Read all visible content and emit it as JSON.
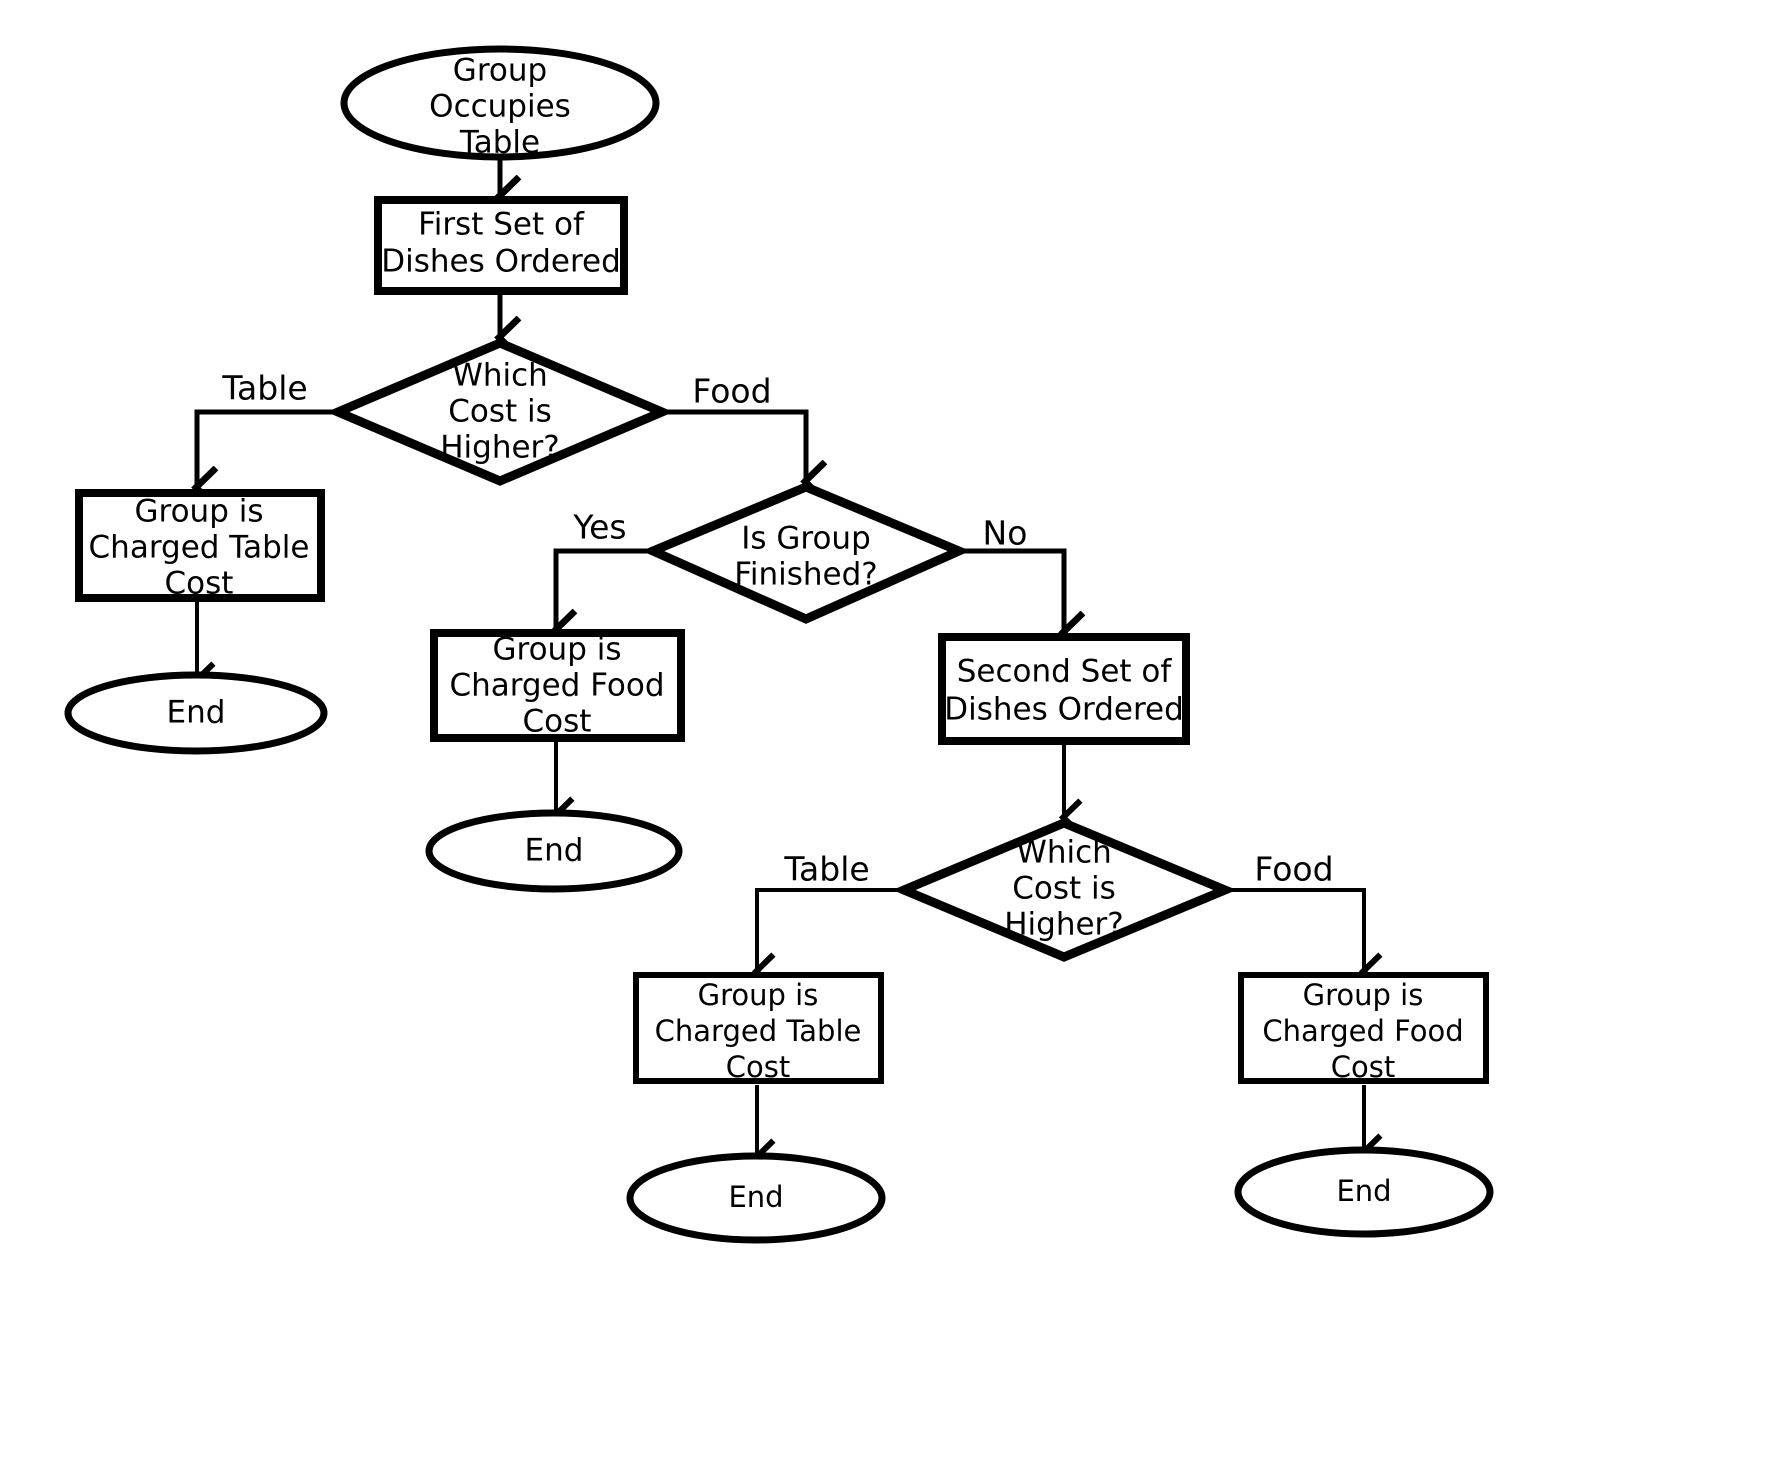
{
  "diagram": {
    "title": "Restaurant Group Charging Flowchart",
    "background_color": "#ffffff",
    "line_color": "#000000",
    "nodes": {
      "start": {
        "label_lines": [
          "Group",
          "Occupies",
          "Table"
        ],
        "shape": "ellipse"
      },
      "first_set": {
        "label_lines": [
          "First Set of",
          "Dishes Ordered"
        ],
        "shape": "rectangle"
      },
      "decision1": {
        "label_lines": [
          "Which",
          "Cost is",
          "Higher?"
        ],
        "shape": "diamond"
      },
      "charged_table_1": {
        "label_lines": [
          "Group is",
          "Charged Table",
          "Cost"
        ],
        "shape": "rectangle"
      },
      "end_1": {
        "label_lines": [
          "End"
        ],
        "shape": "ellipse"
      },
      "decision2": {
        "label_lines": [
          "Is Group",
          "Finished?"
        ],
        "shape": "diamond"
      },
      "charged_food_1": {
        "label_lines": [
          "Group is",
          "Charged Food",
          "Cost"
        ],
        "shape": "rectangle"
      },
      "end_2": {
        "label_lines": [
          "End"
        ],
        "shape": "ellipse"
      },
      "second_set": {
        "label_lines": [
          "Second Set of",
          "Dishes Ordered"
        ],
        "shape": "rectangle"
      },
      "decision3": {
        "label_lines": [
          "Which",
          "Cost is",
          "Higher?"
        ],
        "shape": "diamond"
      },
      "charged_table_2": {
        "label_lines": [
          "Group is",
          "Charged Table",
          "Cost"
        ],
        "shape": "rectangle"
      },
      "end_3": {
        "label_lines": [
          "End"
        ],
        "shape": "ellipse"
      },
      "charged_food_2": {
        "label_lines": [
          "Group is",
          "Charged Food",
          "Cost"
        ],
        "shape": "rectangle"
      },
      "end_4": {
        "label_lines": [
          "End"
        ],
        "shape": "ellipse"
      }
    },
    "edge_labels": {
      "d1_table": "Table",
      "d1_food": "Food",
      "d2_yes": "Yes",
      "d2_no": "No",
      "d3_table": "Table",
      "d3_food": "Food"
    }
  }
}
